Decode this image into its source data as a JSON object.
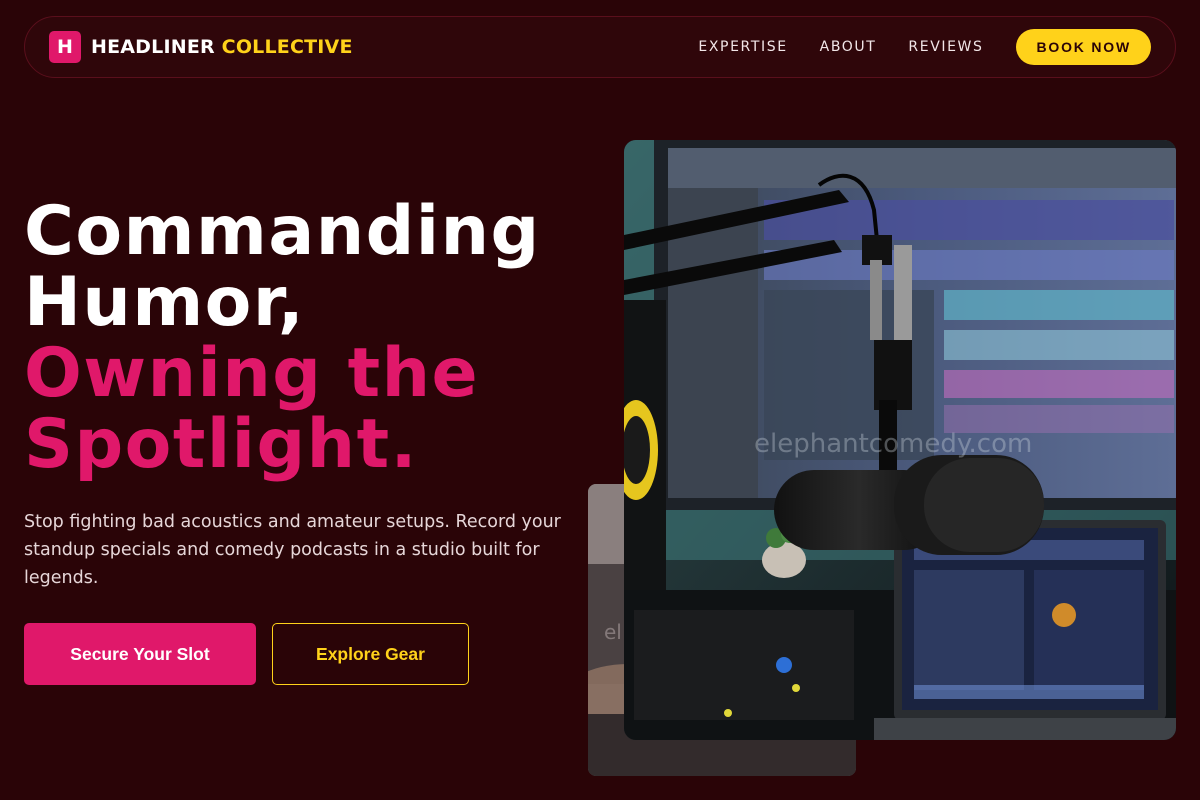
{
  "nav": {
    "logo_letter": "H",
    "brand_word1": "HEADLINER",
    "brand_word2": "COLLECTIVE",
    "links": [
      "EXPERTISE",
      "ABOUT",
      "REVIEWS"
    ],
    "cta": "BOOK NOW"
  },
  "hero": {
    "headline_line1": "Commanding",
    "headline_line2": "Humor,",
    "headline_line3": "Owning the",
    "headline_line4": "Spotlight.",
    "subtext": "Stop fighting bad acoustics and amateur setups. Record your standup specials and comedy podcasts in a studio built for legends.",
    "primary_cta": "Secure Your Slot",
    "secondary_cta": "Explore Gear"
  },
  "images": {
    "main_alt": "Studio microphone in front of a monitor and laptop",
    "watermark": "elephantcomedy.com",
    "back_watermark": "el"
  },
  "colors": {
    "background": "#2a0407",
    "accent_pink": "#e0186a",
    "accent_yellow": "#ffd21a"
  }
}
